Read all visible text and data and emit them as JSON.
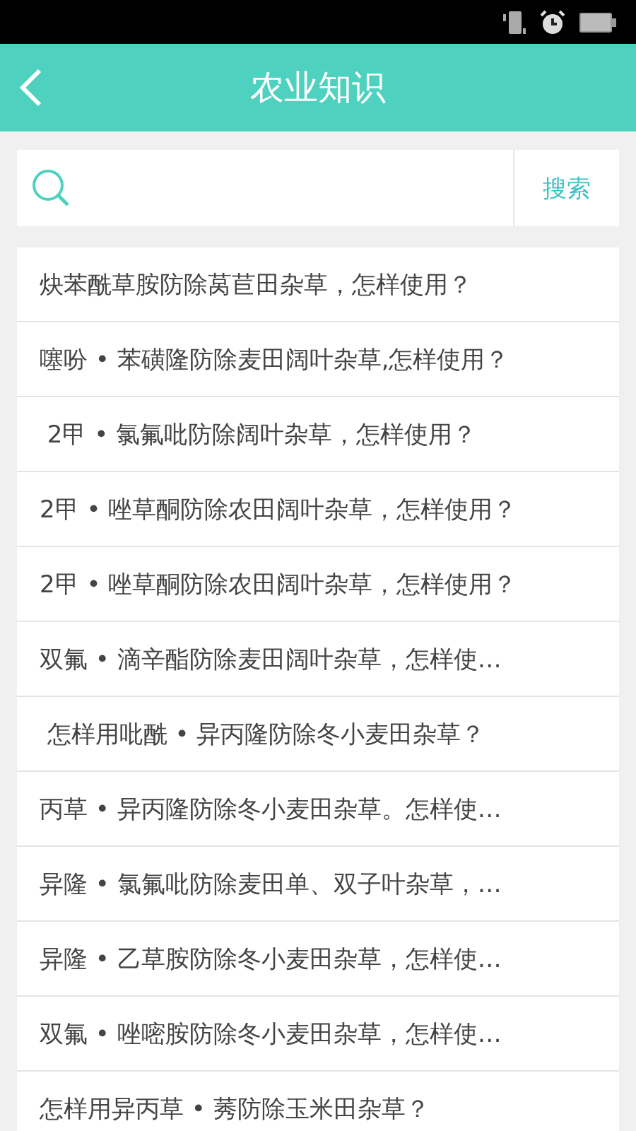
{
  "header": {
    "title": "农业知识"
  },
  "search": {
    "button": "搜索"
  },
  "items": [
    "炔苯酰草胺防除莴苣田杂草，怎样使用？",
    "噻吩 • 苯磺隆防除麦田阔叶杂草,怎样使用？",
    " 2甲 • 氯氟吡防除阔叶杂草，怎样使用？",
    "2甲 • 唑草酮防除农田阔叶杂草，怎样使用？",
    "2甲 • 唑草酮防除农田阔叶杂草，怎样使用？",
    "双氟 • 滴辛酯防除麦田阔叶杂草，怎样使…",
    " 怎样用吡酰 • 异丙隆防除冬小麦田杂草？",
    "丙草 • 异丙隆防除冬小麦田杂草。怎样使…",
    "异隆 • 氯氟吡防除麦田单、双子叶杂草，…",
    "异隆 • 乙草胺防除冬小麦田杂草，怎样使…",
    "双氟 • 唑嘧胺防除冬小麦田杂草，怎样使…",
    "怎样用异丙草 • 莠防除玉米田杂草？"
  ]
}
